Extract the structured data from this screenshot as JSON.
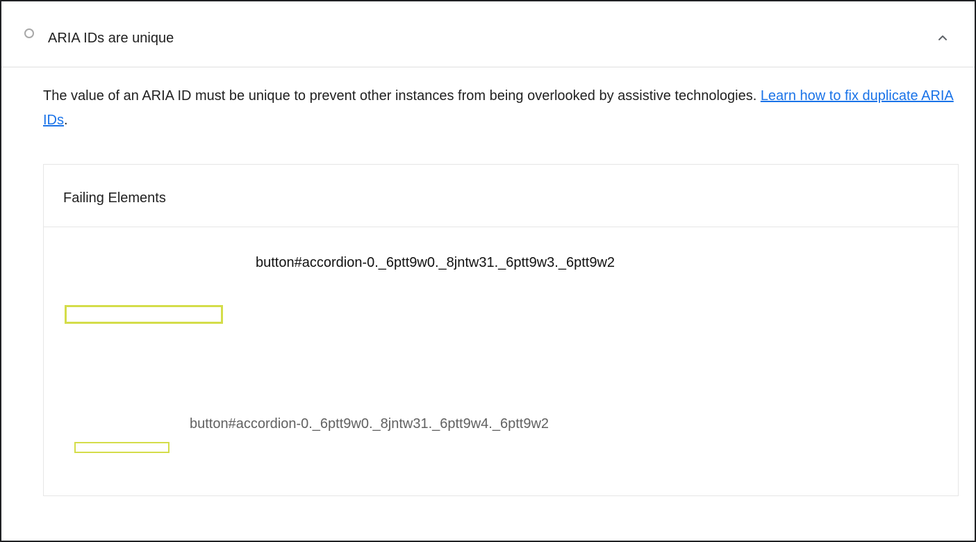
{
  "audit": {
    "title": "ARIA IDs are unique",
    "status": "informative",
    "expanded": true,
    "description": "The value of an ARIA ID must be unique to prevent other instances from being overlooked by assistive technologies. ",
    "link_text": "Learn how to fix duplicate ARIA IDs",
    "after_link": "."
  },
  "table": {
    "header": "Failing Elements",
    "items": [
      {
        "snippet": "button#accordion-0._6ptt9w0._8jntw31._6ptt9w3._6ptt9w2"
      },
      {
        "snippet": "button#accordion-0._6ptt9w0._8jntw31._6ptt9w4._6ptt9w2"
      }
    ]
  },
  "colors": {
    "link": "#1a73e8",
    "highlight": "#d4dd4a",
    "status_icon": "#a8a8a8"
  },
  "icons": {
    "status": "circle-outline-icon",
    "toggle": "chevron-up-icon"
  }
}
